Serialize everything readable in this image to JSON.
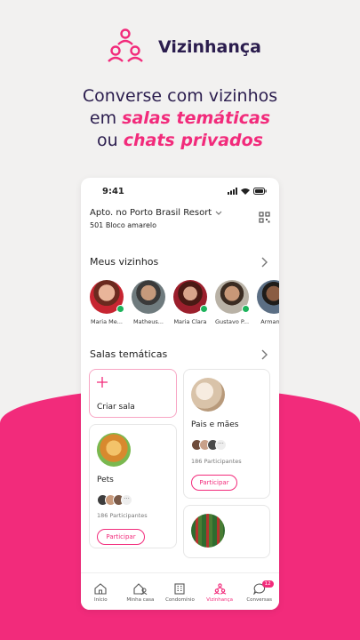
{
  "brand": {
    "name": "Vizinhança",
    "logo_icon": "people-network-icon"
  },
  "headline": {
    "line1": "Converse com vizinhos",
    "line2_pre": "em ",
    "line2_em": "salas temáticas",
    "line3_pre": "ou ",
    "line3_em": "chats privados"
  },
  "colors": {
    "accent": "#f22b7b",
    "navy": "#2b1d4e",
    "online": "#1cb35b"
  },
  "phone": {
    "time": "9:41",
    "address": {
      "title": "Apto. no Porto Brasil Resort",
      "subtitle": "501 Bloco amarelo"
    },
    "neighbors": {
      "title": "Meus vizinhos",
      "items": [
        {
          "name": "Maria Me...",
          "online": true
        },
        {
          "name": "Matheus...",
          "online": false
        },
        {
          "name": "Maria Clara",
          "online": true
        },
        {
          "name": "Gustavo P...",
          "online": true
        },
        {
          "name": "Armando",
          "online": true
        }
      ]
    },
    "rooms": {
      "title": "Salas temáticas",
      "create_label": "Criar sala",
      "items": [
        {
          "name": "Pais e mães",
          "participants": "186 Participantes",
          "action": "Participar"
        },
        {
          "name": "Pets",
          "participants": "186 Participantes",
          "action": "Participar"
        }
      ]
    },
    "tabs": [
      {
        "label": "Início",
        "icon": "home-icon"
      },
      {
        "label": "Minha casa",
        "icon": "house-user-icon"
      },
      {
        "label": "Condomínio",
        "icon": "building-icon"
      },
      {
        "label": "Vizinhança",
        "icon": "people-network-icon",
        "active": true
      },
      {
        "label": "Conversas",
        "icon": "chat-icon",
        "badge": "12"
      }
    ]
  }
}
